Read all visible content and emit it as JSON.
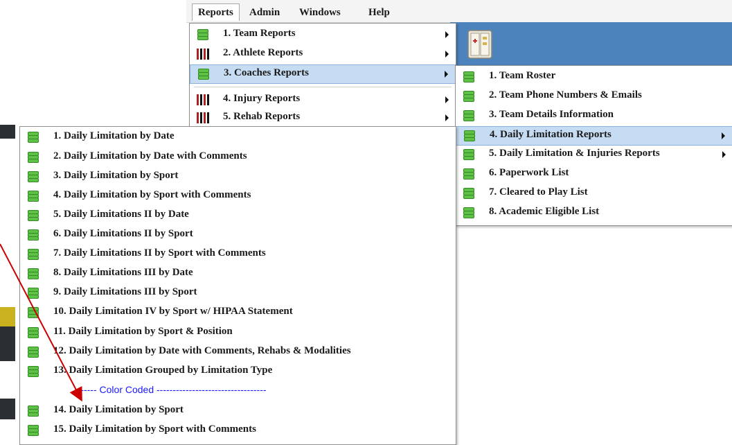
{
  "menubar": {
    "items": [
      "Reports",
      "Admin",
      "Windows",
      "Help"
    ]
  },
  "reports_menu": {
    "items": [
      {
        "label": "1. Team Reports",
        "icon": "database-icon"
      },
      {
        "label": "2. Athlete Reports",
        "icon": "people-icon"
      },
      {
        "label": "3. Coaches Reports",
        "icon": "database-icon"
      },
      {
        "label": "4. Injury Reports",
        "icon": "people-icon"
      },
      {
        "label": "5. Rehab Reports",
        "icon": "people-icon"
      }
    ]
  },
  "coaches_submenu": {
    "items": [
      {
        "label": "1. Team Roster"
      },
      {
        "label": "2. Team Phone Numbers & Emails"
      },
      {
        "label": "3. Team Details Information"
      },
      {
        "label": "4. Daily Limitation Reports"
      },
      {
        "label": "5. Daily Limitation & Injuries Reports"
      },
      {
        "label": "6. Paperwork List"
      },
      {
        "label": "7. Cleared to Play List"
      },
      {
        "label": "8. Academic Eligible List"
      }
    ]
  },
  "daily_limitation_submenu": {
    "items": [
      {
        "label": "1. Daily Limitation by Date"
      },
      {
        "label": "2. Daily Limitation by Date with Comments"
      },
      {
        "label": "3. Daily Limitation by Sport"
      },
      {
        "label": "4. Daily Limitation by Sport with Comments"
      },
      {
        "label": "5. Daily Limitations II by Date"
      },
      {
        "label": "6. Daily Limitations II by Sport"
      },
      {
        "label": "7. Daily Limitations II by Sport with Comments"
      },
      {
        "label": "8. Daily Limitations III by Date"
      },
      {
        "label": "9. Daily Limitations III by Sport"
      },
      {
        "label": "10. Daily Limitation IV  by Sport w/ HIPAA Statement"
      },
      {
        "label": "11. Daily Limitation by Sport & Position"
      },
      {
        "label": "12. Daily Limitation by Date with Comments, Rehabs & Modalities"
      },
      {
        "label": "13. Daily Limitation Grouped by Limitation Type"
      },
      {
        "label": "14. Daily Limitation by Sport"
      },
      {
        "label": "15. Daily Limitation by Sport with Comments"
      }
    ],
    "color_coded_label": "------- Color Coded ----------------------------------"
  },
  "colors": {
    "highlight": "#c6dcf3",
    "banner": "#4c83bd",
    "arrow": "#cc0000",
    "separator_text": "#1a1aff"
  }
}
